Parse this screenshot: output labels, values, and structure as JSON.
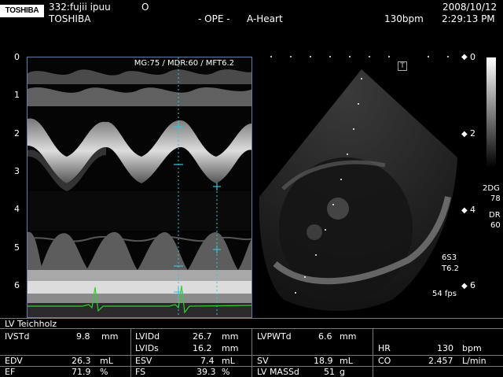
{
  "header": {
    "brand_logo": "TOSHIBA",
    "patient": "332:fujii ipuu",
    "marker": "O",
    "maker": "TOSHIBA",
    "mode": "- OPE -",
    "preset": "A-Heart",
    "date": "2008/10/12",
    "heart_rate": "130bpm",
    "time": "2:29:13 PM"
  },
  "mmode": {
    "title": "MG:75  / MDR:60 / MFT6.2",
    "depth_ticks": [
      "0",
      "1",
      "2",
      "3",
      "4",
      "5",
      "6"
    ]
  },
  "sector": {
    "t_marker": "T",
    "depth_marks": [
      "0",
      "2",
      "4",
      "6"
    ]
  },
  "side_info": {
    "mode_2d": "2DG",
    "gain": "78",
    "dr_label": "DR",
    "dr_value": "60",
    "probe": "6S3",
    "freq": "T6.2",
    "fps": "54 fps"
  },
  "colors": {
    "ecg": "#30d030",
    "caliper": "#40c0d0",
    "frame": "#5f7fa8"
  },
  "measurements": {
    "method": "LV Teichholz",
    "ivstd": {
      "label": "IVSTd",
      "value": "9.8",
      "unit": "mm"
    },
    "lvidd": {
      "label": "LVIDd",
      "value": "26.7",
      "unit": "mm"
    },
    "lvpwtd": {
      "label": "LVPWTd",
      "value": "6.6",
      "unit": "mm"
    },
    "lvids": {
      "label": "LVIDs",
      "value": "16.2",
      "unit": "mm"
    },
    "hr": {
      "label": "HR",
      "value": "130",
      "unit": "bpm"
    },
    "edv": {
      "label": "EDV",
      "value": "26.3",
      "unit": "mL"
    },
    "esv": {
      "label": "ESV",
      "value": "7.4",
      "unit": "mL"
    },
    "sv": {
      "label": "SV",
      "value": "18.9",
      "unit": "mL"
    },
    "co": {
      "label": "CO",
      "value": "2.457",
      "unit": "L/min"
    },
    "ef": {
      "label": "EF",
      "value": "71.9",
      "unit": "%"
    },
    "fs": {
      "label": "FS",
      "value": "39.3",
      "unit": "%"
    },
    "lvmass": {
      "label": "LV MASSd",
      "value": "51",
      "unit": "g"
    }
  }
}
